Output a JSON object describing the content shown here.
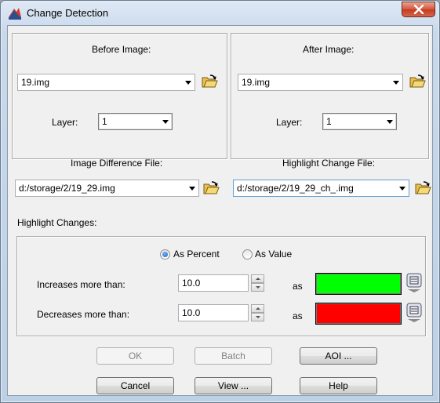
{
  "window": {
    "title": "Change Detection"
  },
  "before": {
    "heading": "Before Image:",
    "file": "19.img",
    "layer_label": "Layer:",
    "layer": "1"
  },
  "after": {
    "heading": "After Image:",
    "file": "19.img",
    "layer_label": "Layer:",
    "layer": "1"
  },
  "diff": {
    "heading": "Image Difference File:",
    "file": "d:/storage/2/19_29.img"
  },
  "highlight_file": {
    "heading": "Highlight Change File:",
    "file": "d:/storage/2/19_29_ch_.img"
  },
  "changes": {
    "heading": "Highlight Changes:",
    "as_percent": "As Percent",
    "as_value": "As Value",
    "selected_mode": "As Percent",
    "increase_label": "Increases more than:",
    "increase_value": "10.0",
    "increase_color": "#00ff00",
    "decrease_label": "Decreases more than:",
    "decrease_value": "10.0",
    "decrease_color": "#ff0000",
    "as_text": "as"
  },
  "buttons": {
    "ok": "OK",
    "batch": "Batch",
    "aoi": "AOI ...",
    "cancel": "Cancel",
    "view": "View ...",
    "help": "Help"
  }
}
